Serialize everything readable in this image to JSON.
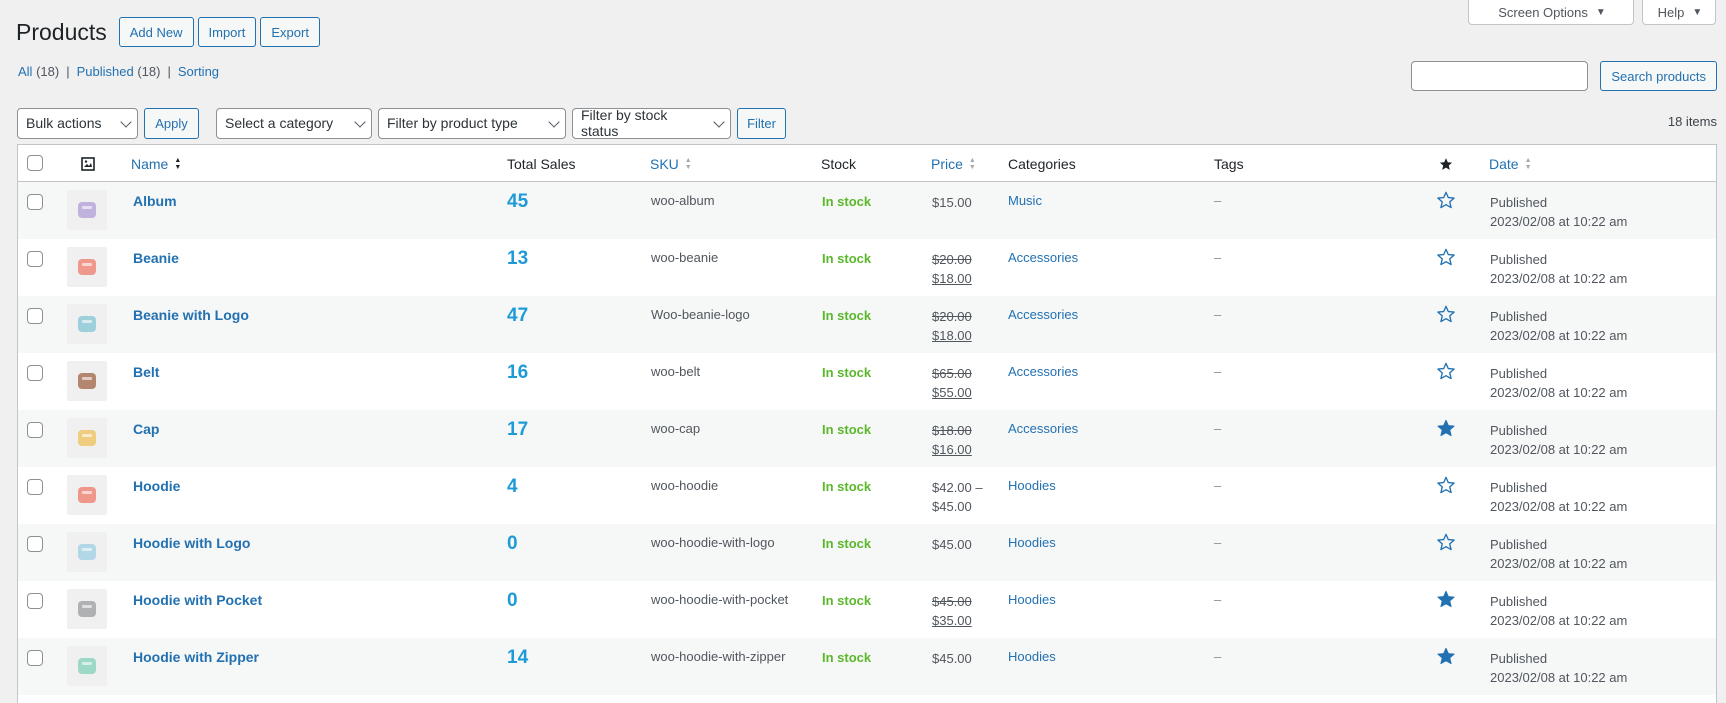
{
  "screen_meta": {
    "screen_options": "Screen Options",
    "help": "Help"
  },
  "header": {
    "title": "Products",
    "add_new": "Add New",
    "import": "Import",
    "export": "Export"
  },
  "views": [
    {
      "label": "All",
      "count": "(18)"
    },
    {
      "label": "Published",
      "count": "(18)"
    },
    {
      "label": "Sorting",
      "count": ""
    }
  ],
  "search": {
    "placeholder": "",
    "button": "Search products"
  },
  "tablenav": {
    "bulk_actions": "Bulk actions",
    "apply": "Apply",
    "category": "Select a category",
    "product_type": "Filter by product type",
    "stock_status": "Filter by stock status",
    "filter": "Filter",
    "items_count": "18 items"
  },
  "columns": {
    "name": "Name",
    "total_sales": "Total Sales",
    "sku": "SKU",
    "stock": "Stock",
    "price": "Price",
    "categories": "Categories",
    "tags": "Tags",
    "date": "Date"
  },
  "products": [
    {
      "name": "Album",
      "sales": "45",
      "sku": "woo-album",
      "stock": "In stock",
      "price_regular": "$15.00",
      "price_sale": "",
      "category": "Music",
      "tags": "–",
      "featured": false,
      "status": "Published",
      "date": "2023/02/08 at 10:22 am",
      "thumb_color": "#b9a7d9",
      "thumb_icon": "album-icon"
    },
    {
      "name": "Beanie",
      "sales": "13",
      "sku": "woo-beanie",
      "stock": "In stock",
      "price_regular": "$20.00",
      "price_sale": "$18.00",
      "category": "Accessories",
      "tags": "–",
      "featured": false,
      "status": "Published",
      "date": "2023/02/08 at 10:22 am",
      "thumb_color": "#ef8a7a",
      "thumb_icon": "beanie-icon"
    },
    {
      "name": "Beanie with Logo",
      "sales": "47",
      "sku": "Woo-beanie-logo",
      "stock": "In stock",
      "price_regular": "$20.00",
      "price_sale": "$18.00",
      "category": "Accessories",
      "tags": "–",
      "featured": false,
      "status": "Published",
      "date": "2023/02/08 at 10:22 am",
      "thumb_color": "#8fcad8",
      "thumb_icon": "beanie-logo-icon"
    },
    {
      "name": "Belt",
      "sales": "16",
      "sku": "woo-belt",
      "stock": "In stock",
      "price_regular": "$65.00",
      "price_sale": "$55.00",
      "category": "Accessories",
      "tags": "–",
      "featured": false,
      "status": "Published",
      "date": "2023/02/08 at 10:22 am",
      "thumb_color": "#a87358",
      "thumb_icon": "belt-icon"
    },
    {
      "name": "Cap",
      "sales": "17",
      "sku": "woo-cap",
      "stock": "In stock",
      "price_regular": "$18.00",
      "price_sale": "$16.00",
      "category": "Accessories",
      "tags": "–",
      "featured": true,
      "status": "Published",
      "date": "2023/02/08 at 10:22 am",
      "thumb_color": "#f0c66b",
      "thumb_icon": "cap-icon"
    },
    {
      "name": "Hoodie",
      "sales": "4",
      "sku": "woo-hoodie",
      "stock": "In stock",
      "price_regular": "$42.00 –",
      "price_sale": "$45.00",
      "price_range": true,
      "category": "Hoodies",
      "tags": "–",
      "featured": false,
      "status": "Published",
      "date": "2023/02/08 at 10:22 am",
      "thumb_color": "#ee8778",
      "thumb_icon": "hoodie-icon"
    },
    {
      "name": "Hoodie with Logo",
      "sales": "0",
      "sku": "woo-hoodie-with-logo",
      "stock": "In stock",
      "price_regular": "$45.00",
      "price_sale": "",
      "category": "Hoodies",
      "tags": "–",
      "featured": false,
      "status": "Published",
      "date": "2023/02/08 at 10:22 am",
      "thumb_color": "#a7d3e6",
      "thumb_icon": "hoodie-logo-icon"
    },
    {
      "name": "Hoodie with Pocket",
      "sales": "0",
      "sku": "woo-hoodie-with-pocket",
      "stock": "In stock",
      "price_regular": "$45.00",
      "price_sale": "$35.00",
      "category": "Hoodies",
      "tags": "–",
      "featured": true,
      "status": "Published",
      "date": "2023/02/08 at 10:22 am",
      "thumb_color": "#a4a6a8",
      "thumb_icon": "hoodie-pocket-icon"
    },
    {
      "name": "Hoodie with Zipper",
      "sales": "14",
      "sku": "woo-hoodie-with-zipper",
      "stock": "In stock",
      "price_regular": "$45.00",
      "price_sale": "",
      "category": "Hoodies",
      "tags": "–",
      "featured": true,
      "status": "Published",
      "date": "2023/02/08 at 10:22 am",
      "thumb_color": "#8fd3bf",
      "thumb_icon": "hoodie-zipper-icon"
    }
  ],
  "colors": {
    "link": "#2271b1",
    "in_stock": "#5cb82b",
    "sales": "#1e9bd7",
    "featured_star": "#2271b1"
  }
}
